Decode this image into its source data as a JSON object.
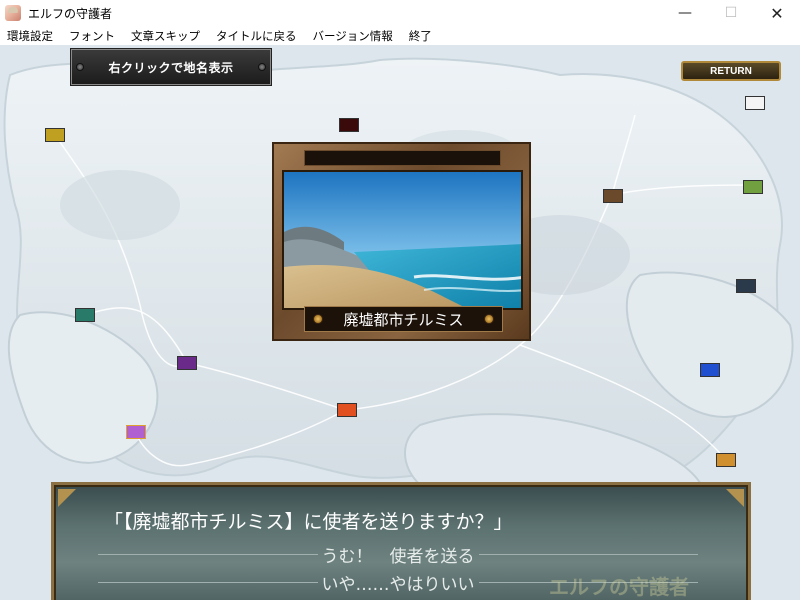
{
  "window": {
    "title": "エルフの守護者",
    "buttons": {
      "minimize": "—",
      "maximize": "☐",
      "close": "✕"
    }
  },
  "menu": {
    "items": [
      "環境設定",
      "フォント",
      "文章スキップ",
      "タイトルに戻る",
      "バージョン情報",
      "終了"
    ]
  },
  "hint": {
    "label": "右クリックで地名表示"
  },
  "return_button": {
    "label": "RETURN"
  },
  "location": {
    "name": "廃墟都市チルミス"
  },
  "dialog": {
    "question": "「【廃墟都市チルミス】に使者を送りますか？」",
    "choices": [
      "うむ！　使者を送る",
      "いや……やはりいい"
    ],
    "watermark": "エルフの守護者"
  },
  "colors": {
    "frame_brown": "#8a6440",
    "dialog_teal": "#5c7270",
    "panel_dark": "#1c1c1c"
  }
}
